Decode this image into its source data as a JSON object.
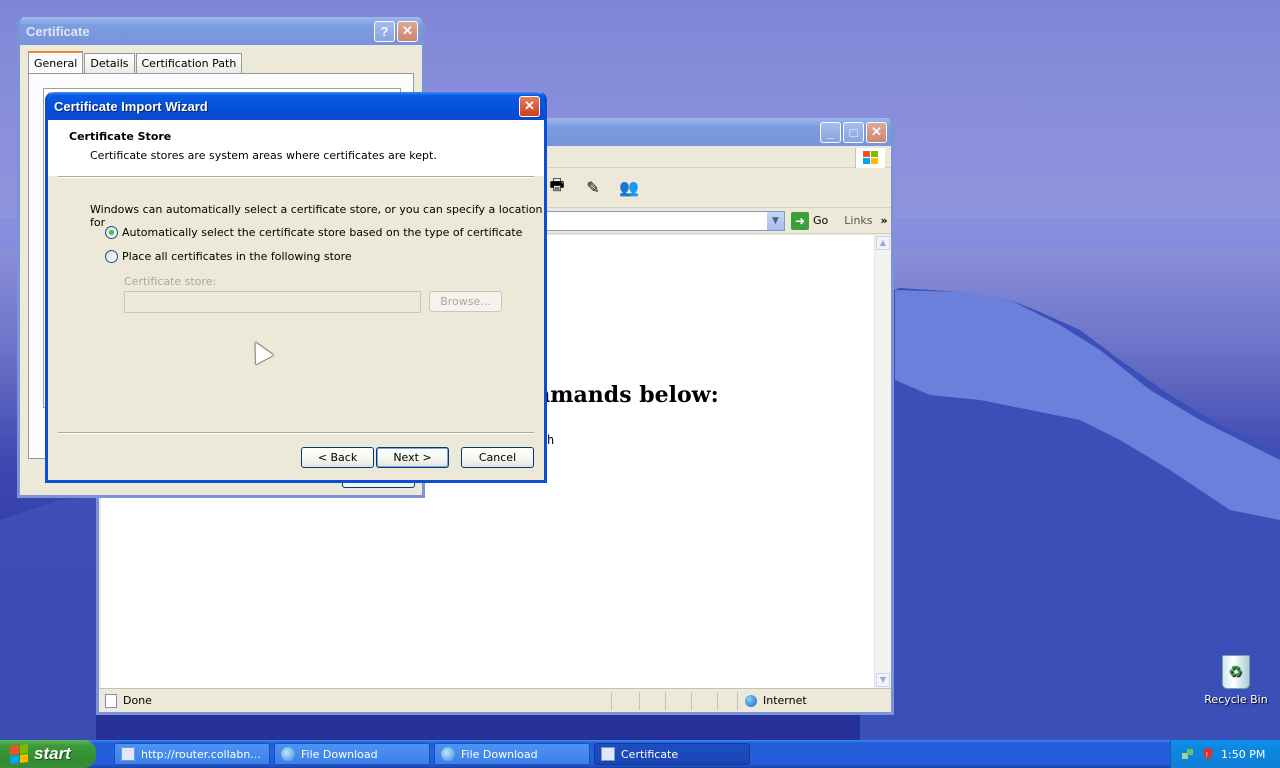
{
  "desktop": {
    "recycle_bin_label": "Recycle Bin"
  },
  "browser": {
    "title": "",
    "go_label": "Go",
    "links_label": "Links",
    "heading": "mmands below:",
    "mono_text": "h",
    "status_text": "Done",
    "zone_text": "Internet"
  },
  "certificate": {
    "title": "Certificate",
    "help_label": "?",
    "tabs": [
      {
        "label": "General"
      },
      {
        "label": "Details"
      },
      {
        "label": "Certification Path"
      }
    ]
  },
  "wizard": {
    "title": "Certificate Import Wizard",
    "section_title": "Certificate Store",
    "section_desc": "Certificate stores are system areas where certificates are kept.",
    "intro": "Windows can automatically select a certificate store, or you can specify a location for",
    "option_auto": "Automatically select the certificate store based on the type of certificate",
    "option_manual": "Place all certificates in the following store",
    "store_label": "Certificate store:",
    "store_value": "",
    "browse_label": "Browse...",
    "back_label": "< Back",
    "next_label": "Next >",
    "cancel_label": "Cancel"
  },
  "taskbar": {
    "start_label": "start",
    "tasks": [
      {
        "label": "http://router.collabn..."
      },
      {
        "label": "File Download"
      },
      {
        "label": "File Download"
      },
      {
        "label": "Certificate"
      }
    ],
    "clock": "1:50 PM"
  },
  "colors": {
    "title_active": "#0450d8",
    "start_green": "#2f8d2f",
    "taskbar_blue": "#245edb"
  }
}
